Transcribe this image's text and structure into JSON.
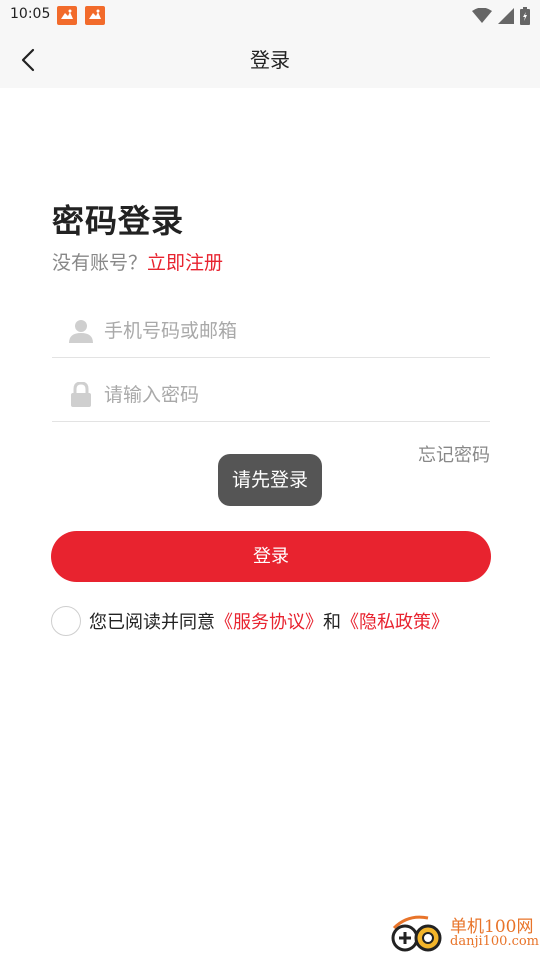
{
  "status_bar": {
    "time": "10:05"
  },
  "header": {
    "title": "登录",
    "back_icon": "chevron-left-icon"
  },
  "login": {
    "heading": "密码登录",
    "no_account_text": "没有账号？",
    "register_link": "立即注册",
    "account_field": {
      "placeholder": "手机号码或邮箱",
      "value": "",
      "icon": "user-icon"
    },
    "password_field": {
      "placeholder": "请输入密码",
      "value": "",
      "icon": "lock-icon"
    },
    "forgot_password": "忘记密码",
    "toast": "请先登录",
    "login_button": "登录",
    "agreement": {
      "prefix": "您已阅读并同意",
      "service_link": "《服务协议》",
      "connector": "和",
      "privacy_link": "《隐私政策》",
      "checked": false
    }
  },
  "watermark": {
    "title": "单机100网",
    "url": "danji100.com"
  },
  "colors": {
    "accent": "#e8232f",
    "toast_bg": "#555555",
    "watermark": "#e8742a"
  }
}
